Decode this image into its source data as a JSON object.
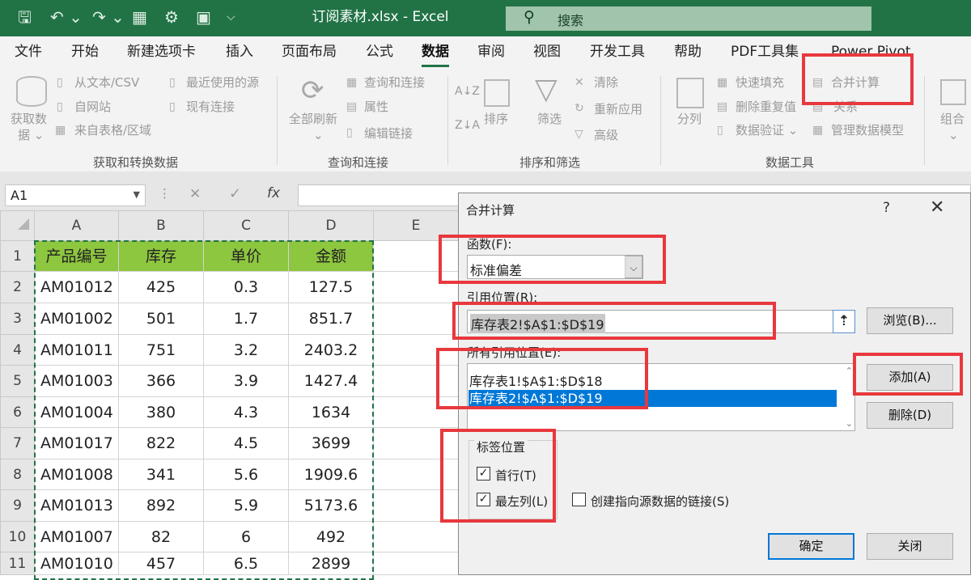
{
  "titlebar": {
    "qat": {
      "save": "🖫",
      "undo": "↶ ⌄",
      "redo": "↷ ⌄",
      "form": "▦",
      "settings": "⚙",
      "view": "▣",
      "customize": "⌵"
    },
    "title": "订阅素材.xlsx  -  Excel",
    "search_placeholder": "搜索"
  },
  "menu": [
    "文件",
    "开始",
    "新建选项卡",
    "插入",
    "页面布局",
    "公式",
    "数据",
    "审阅",
    "视图",
    "开发工具",
    "帮助",
    "PDF工具集",
    "Power Pivot"
  ],
  "ribbon": {
    "get_data": {
      "big1": "获取数",
      "big2": "据 ⌄",
      "from_text": "从文本/CSV",
      "from_web": "自网站",
      "from_table": "来自表格/区域",
      "recent": "最近使用的源",
      "existing": "现有连接",
      "label": "获取和转换数据"
    },
    "queries": {
      "refresh1": "全部刷新",
      "refresh2": "⌄",
      "queries": "查询和连接",
      "properties": "属性",
      "edit_links": "编辑链接",
      "label": "查询和连接"
    },
    "sort": {
      "sort_az": "A↓Z",
      "sort_za": "Z↓A",
      "sort": "排序",
      "filter": "筛选",
      "clear": "清除",
      "reapply": "重新应用",
      "advanced": "高级",
      "label": "排序和筛选"
    },
    "tools": {
      "split": "分列",
      "flash": "快速填充",
      "dedupe": "删除重复值",
      "validate": "数据验证  ⌄",
      "consolidate": "合并计算",
      "relations": "关系",
      "model": "管理数据模型",
      "label": "数据工具"
    },
    "group": {
      "label": "组合",
      "arrow": "⌄"
    }
  },
  "formula_bar": {
    "name": "A1",
    "cancel": "✕",
    "enter": "✓",
    "fx": "fx"
  },
  "sheet": {
    "columns": [
      "A",
      "B",
      "C",
      "D",
      "E"
    ],
    "headers": [
      "产品编号",
      "库存",
      "单价",
      "金额"
    ],
    "rows": [
      [
        "AM01012",
        "425",
        "0.3",
        "127.5"
      ],
      [
        "AM01002",
        "501",
        "1.7",
        "851.7"
      ],
      [
        "AM01011",
        "751",
        "3.2",
        "2403.2"
      ],
      [
        "AM01003",
        "366",
        "3.9",
        "1427.4"
      ],
      [
        "AM01004",
        "380",
        "4.3",
        "1634"
      ],
      [
        "AM01017",
        "822",
        "4.5",
        "3699"
      ],
      [
        "AM01008",
        "341",
        "5.6",
        "1909.6"
      ],
      [
        "AM01013",
        "892",
        "5.9",
        "5173.6"
      ],
      [
        "AM01007",
        "82",
        "6",
        "492"
      ],
      [
        "AM01010",
        "457",
        "6.5",
        "2899"
      ]
    ],
    "row_numbers": [
      "1",
      "2",
      "3",
      "4",
      "5",
      "6",
      "7",
      "8",
      "9",
      "10",
      "11"
    ]
  },
  "dialog": {
    "title": "合并计算",
    "help": "?",
    "close_x": "✕",
    "function_label": "函数(F):",
    "function_value": "标准偏差",
    "reference_label": "引用位置(R):",
    "reference_value": "库存表2!$A$1:$D$19",
    "browse": "浏览(B)...",
    "all_refs_label": "所有引用位置(E):",
    "all_refs": [
      "库存表1!$A$1:$D$18",
      "库存表2!$A$1:$D$19"
    ],
    "add": "添加(A)",
    "delete": "删除(D)",
    "labels_group": "标签位置",
    "top_row": "首行(T)",
    "left_col": "最左列(L)",
    "create_links": "创建指向源数据的链接(S)",
    "ok": "确定",
    "close": "关闭",
    "check": "✓"
  },
  "colors": {
    "excel_green": "#217346",
    "header_fill": "#8dc63f",
    "highlight": "#e8383d",
    "selection": "#0078d7"
  }
}
